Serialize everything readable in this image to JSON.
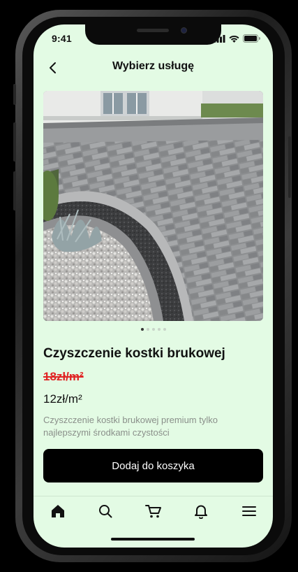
{
  "status_bar": {
    "time": "9:41"
  },
  "header": {
    "title": "Wybierz usługę",
    "back_icon": "chevron-left-icon"
  },
  "product": {
    "image": "paving-stones-driveway-photo",
    "carousel": {
      "count": 5,
      "active_index": 0
    },
    "title": "Czyszczenie kostki brukowej",
    "old_price": "18zł/m²",
    "price": "12zł/m²",
    "description": "Czyszczenie kostki brukowej premium tylko najlepszymi środkami czystości"
  },
  "cta": {
    "label": "Dodaj do koszyka"
  },
  "tabbar": {
    "items": [
      {
        "icon": "home-icon",
        "active": true
      },
      {
        "icon": "search-icon",
        "active": false
      },
      {
        "icon": "cart-icon",
        "active": false
      },
      {
        "icon": "bell-icon",
        "active": false
      },
      {
        "icon": "menu-icon",
        "active": false
      }
    ]
  },
  "colors": {
    "screen_bg": "#e3fbe4",
    "old_price": "#e02424",
    "cta_bg": "#000000"
  }
}
